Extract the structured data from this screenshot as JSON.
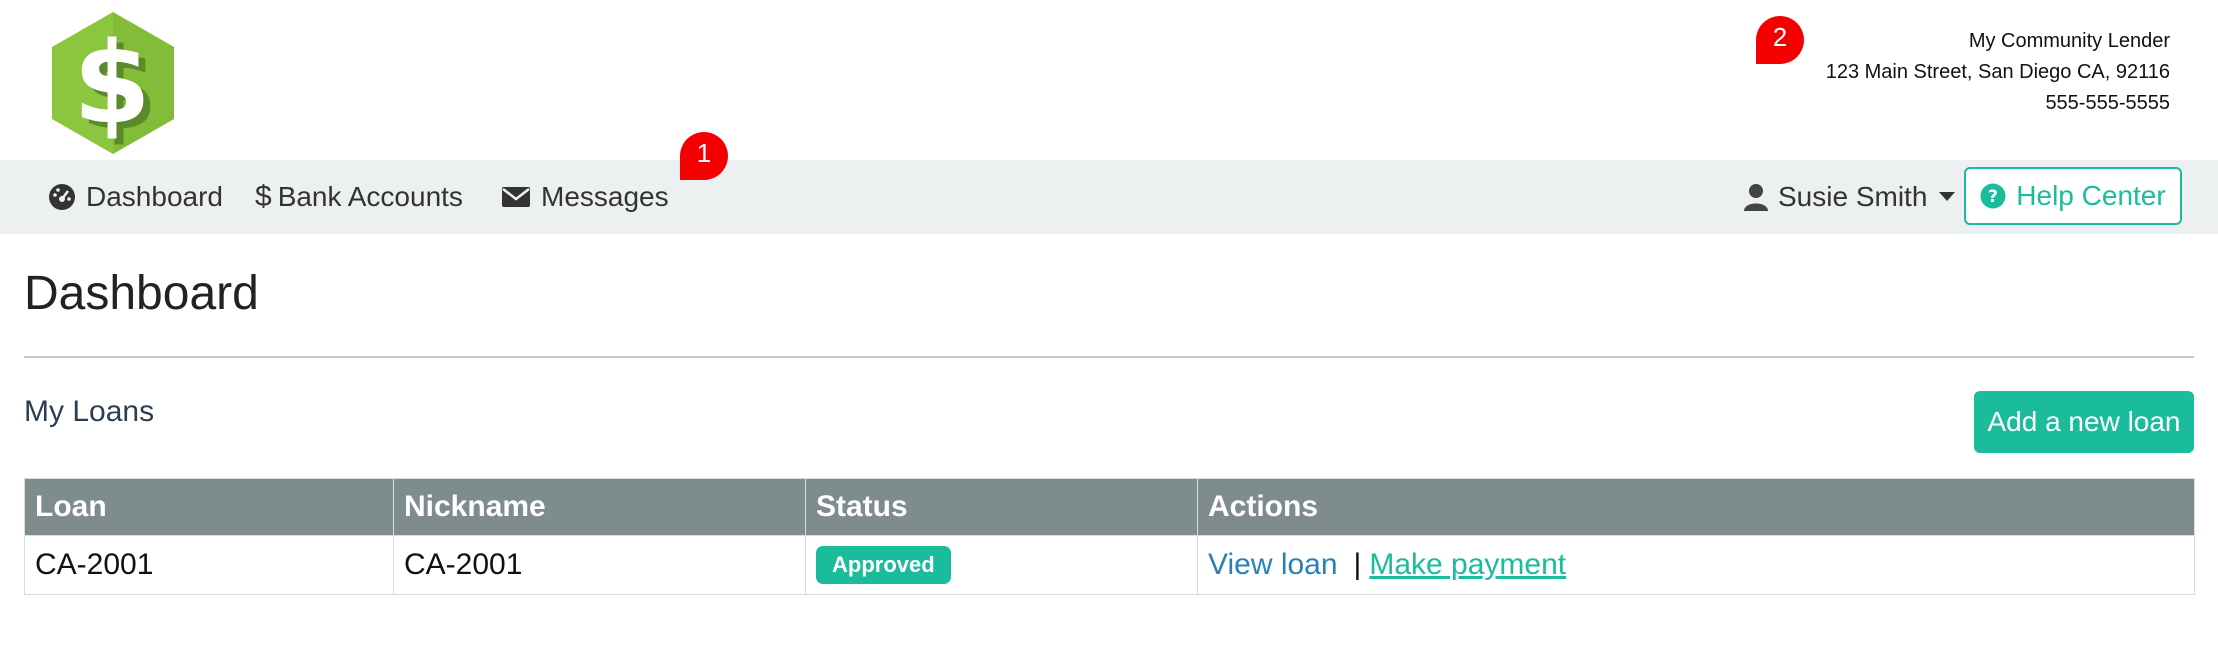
{
  "header": {
    "lender_name": "My Community Lender",
    "address": "123 Main Street, San Diego CA, 92116",
    "phone": "555-555-5555",
    "logo_icon": "dollar-hexagon-logo",
    "logo_color": "#8cc63f"
  },
  "markers": {
    "first": "1",
    "second": "2",
    "color": "#f50000"
  },
  "nav": {
    "items": [
      {
        "label": "Dashboard",
        "icon": "dashboard-gauge-icon"
      },
      {
        "label": "Bank Accounts",
        "icon": "dollar-icon"
      },
      {
        "label": "Messages",
        "icon": "envelope-icon"
      }
    ],
    "user": {
      "label": "Susie Smith",
      "icon": "user-icon"
    },
    "help": {
      "label": "Help Center",
      "icon": "question-circle-icon"
    }
  },
  "main": {
    "title": "Dashboard",
    "section_title": "My Loans",
    "add_button": "Add a new loan",
    "table": {
      "columns": [
        "Loan",
        "Nickname",
        "Status",
        "Actions"
      ],
      "rows": [
        {
          "loan": "CA-2001",
          "nickname": "CA-2001",
          "status": "Approved",
          "actions": {
            "view": "View loan",
            "separator": "|",
            "pay": "Make payment"
          }
        }
      ]
    }
  },
  "colors": {
    "accent": "#1abc9c",
    "link": "#2980b9",
    "navbar_bg": "#ecf0f1",
    "table_header_bg": "#7f8c8d"
  }
}
